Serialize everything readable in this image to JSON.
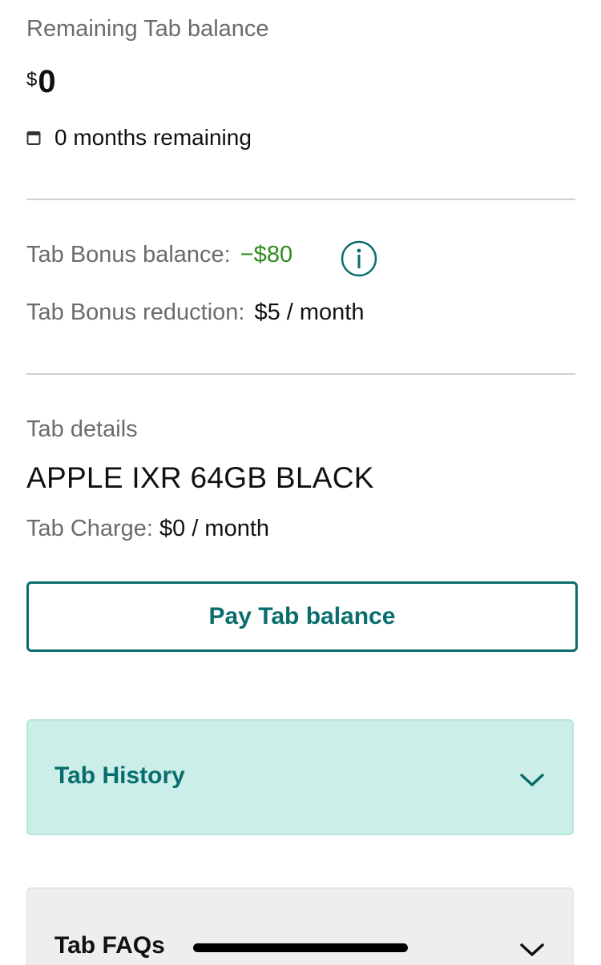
{
  "tab_summary": {
    "remaining_label": "Remaining Tab balance",
    "currency_symbol": "$",
    "balance_amount": "0",
    "months_remaining": "0 months remaining"
  },
  "bonus": {
    "balance_label": "Tab Bonus balance:",
    "balance_value": "−$80",
    "reduction_label": "Tab Bonus reduction:",
    "reduction_value": "$5 / month",
    "positive_color": "#2e8b1c"
  },
  "details": {
    "section_label": "Tab details",
    "device_name": "APPLE IXR 64GB BLACK",
    "charge_label": "Tab Charge:",
    "charge_value": "$0 / month"
  },
  "actions": {
    "pay_button_label": "Pay Tab balance"
  },
  "accordions": [
    {
      "title": "Tab History",
      "icon": "chevron-down-icon",
      "expanded": false
    },
    {
      "title": "Tab FAQs",
      "icon": "chevron-down-icon",
      "expanded": false
    }
  ],
  "colors": {
    "accent": "#0a6d6d",
    "history_bg": "#cbefe8",
    "faqs_bg": "#eeeeee"
  }
}
